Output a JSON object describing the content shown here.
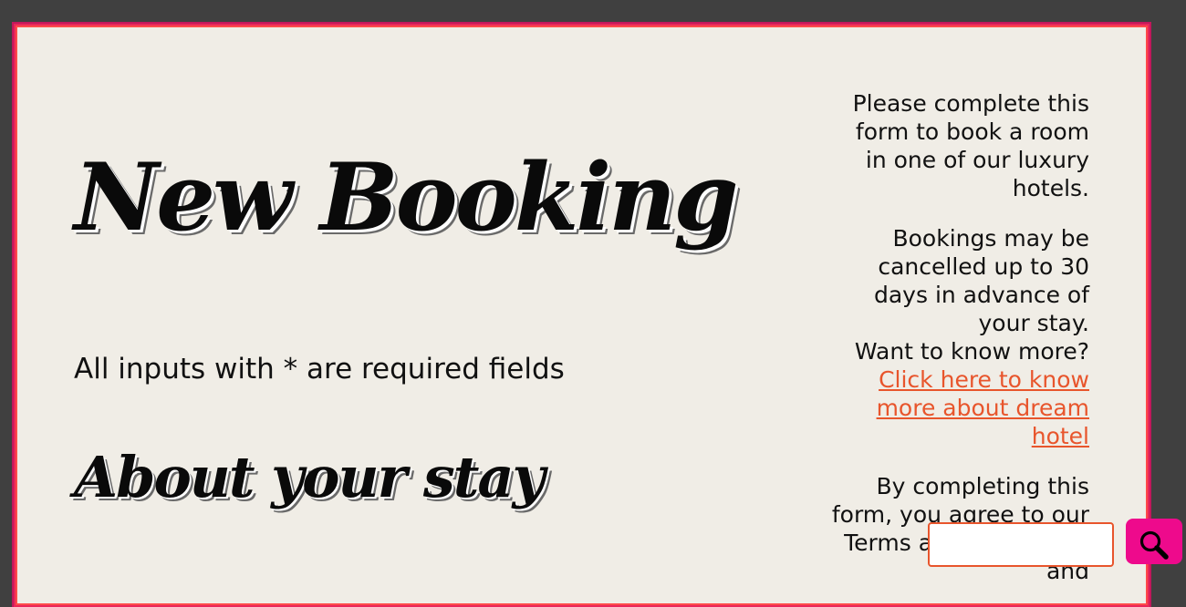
{
  "header": {
    "title": "New Booking"
  },
  "form": {
    "required_note": "All inputs with * are required fields",
    "section_heading": "About your stay"
  },
  "aside": {
    "intro": "Please complete this form to book a room in one of our luxury hotels.",
    "cancellation": "Bookings may be cancelled up to 30 days in advance of your stay.",
    "more_prompt": "Want to know more?",
    "more_link": "Click here to know more about dream hotel",
    "agreement": "By completing this form, you agree to our Terms and Conditions and"
  },
  "search": {
    "value": "",
    "icon": "search-icon"
  },
  "colors": {
    "frame_border": "#e8275a",
    "link": "#e8552c",
    "search_button": "#ee0a8c",
    "page_background": "#f0ede6",
    "outer_background": "#404040"
  }
}
